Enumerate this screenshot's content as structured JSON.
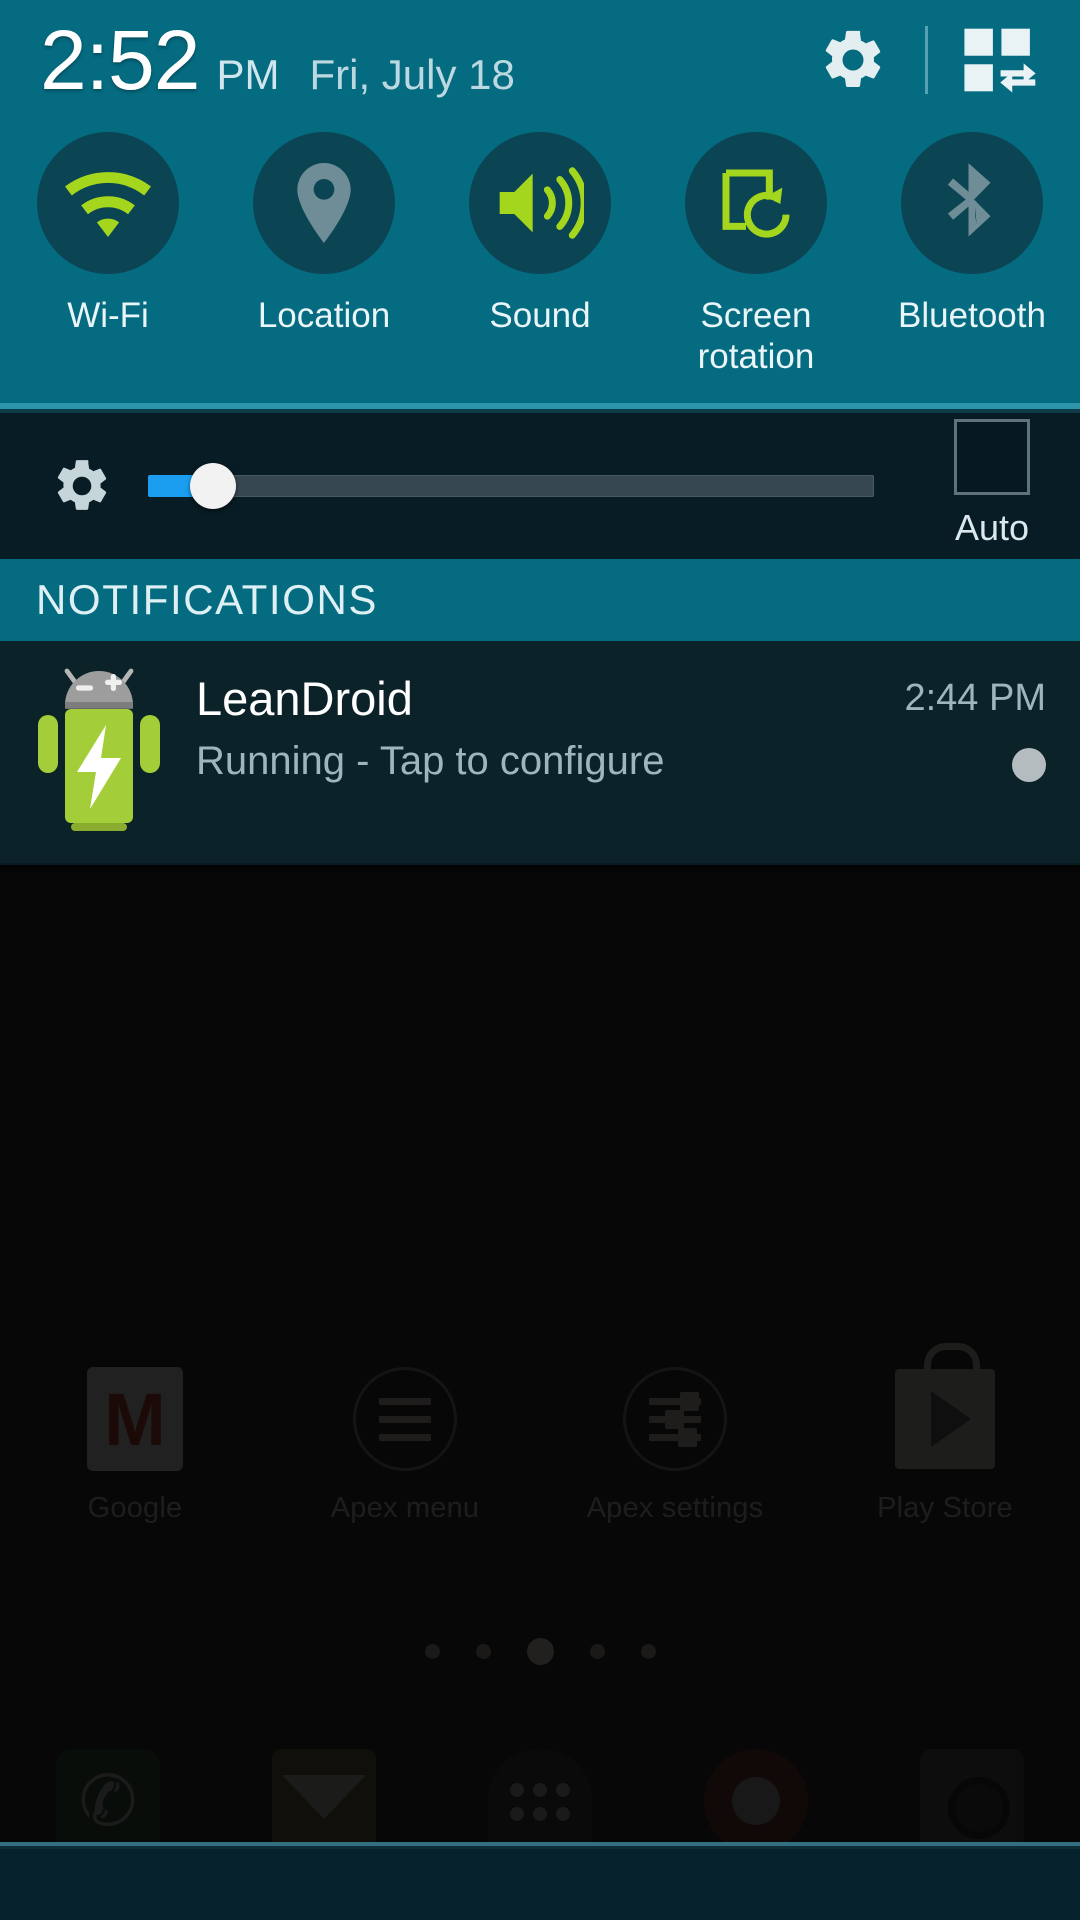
{
  "status_bar": {
    "time": "2:52",
    "ampm": "PM",
    "date": "Fri, July 18",
    "gear_icon": "gear-icon",
    "grid_icon": "quick-settings-grid-icon"
  },
  "quick_settings": {
    "toggles": [
      {
        "label": "Wi-Fi",
        "icon": "wifi-icon",
        "state": "on",
        "color": "#a4d61e"
      },
      {
        "label": "Location",
        "icon": "location-pin-icon",
        "state": "off",
        "color": "#6e8d96"
      },
      {
        "label": "Sound",
        "icon": "sound-speaker-icon",
        "state": "on",
        "color": "#a4d61e"
      },
      {
        "label": "Screen\nrotation",
        "icon": "screen-rotation-icon",
        "state": "on",
        "color": "#a4d61e"
      },
      {
        "label": "Bluetooth",
        "icon": "bluetooth-icon",
        "state": "off",
        "color": "#6e8d96"
      }
    ],
    "toggle_circle_color": "#0b4452",
    "panel_color": "#056B80"
  },
  "brightness": {
    "gear_icon": "brightness-gear-icon",
    "value_percent": 9,
    "fill_color": "#1b9df0",
    "auto_label": "Auto",
    "auto_checked": false
  },
  "notifications_section": {
    "header": "NOTIFICATIONS",
    "items": [
      {
        "app": "LeanDroid",
        "text": "Running - Tap to configure",
        "time": "2:44 PM",
        "icon": "leandroid-battery-android-icon",
        "expand_indicator": "expand-dot-icon"
      }
    ]
  },
  "home_screen": {
    "apps": [
      {
        "label": "Google",
        "icon": "gmail-icon"
      },
      {
        "label": "Apex menu",
        "icon": "hamburger-menu-circle-icon"
      },
      {
        "label": "Apex settings",
        "icon": "sliders-circle-icon"
      },
      {
        "label": "Play Store",
        "icon": "play-store-bag-icon"
      }
    ],
    "page_dots": 5,
    "active_dot": 3,
    "dock": [
      {
        "icon": "phone-icon"
      },
      {
        "icon": "messaging-icon"
      },
      {
        "icon": "app-drawer-icon"
      },
      {
        "icon": "chrome-icon"
      },
      {
        "icon": "camera-icon"
      }
    ]
  }
}
